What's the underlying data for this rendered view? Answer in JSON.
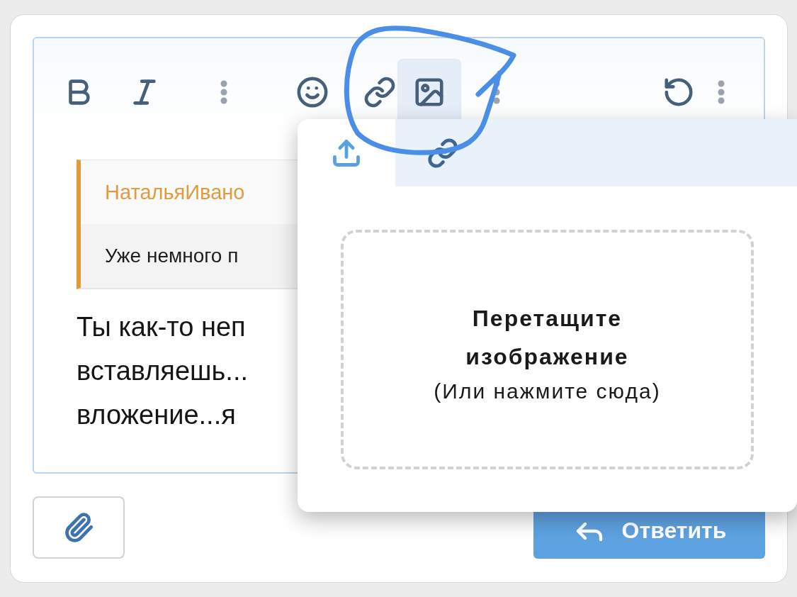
{
  "toolbar": [
    {
      "kind": "bold",
      "selected": false
    },
    {
      "kind": "italic",
      "selected": false
    },
    {
      "kind": "more",
      "selected": false
    },
    {
      "kind": "emoji",
      "selected": false
    },
    {
      "kind": "link",
      "selected": false
    },
    {
      "kind": "image",
      "selected": true
    },
    {
      "kind": "more",
      "selected": false
    },
    {
      "kind": "undo",
      "selected": false
    },
    {
      "kind": "more",
      "selected": false
    }
  ],
  "quote": {
    "author": "НатальяИвано",
    "text": "Уже немного п"
  },
  "message_lines": [
    "Ты как-то неп",
    "вставляешь...",
    "вложение...я"
  ],
  "popup": {
    "tabs": [
      {
        "kind": "upload",
        "selected": true
      },
      {
        "kind": "link",
        "selected": false
      }
    ],
    "dropzone": {
      "title": "Перетащите изображение",
      "hint": "(Или нажмите сюда)"
    }
  },
  "reply_button": {
    "label": "Ответить"
  }
}
